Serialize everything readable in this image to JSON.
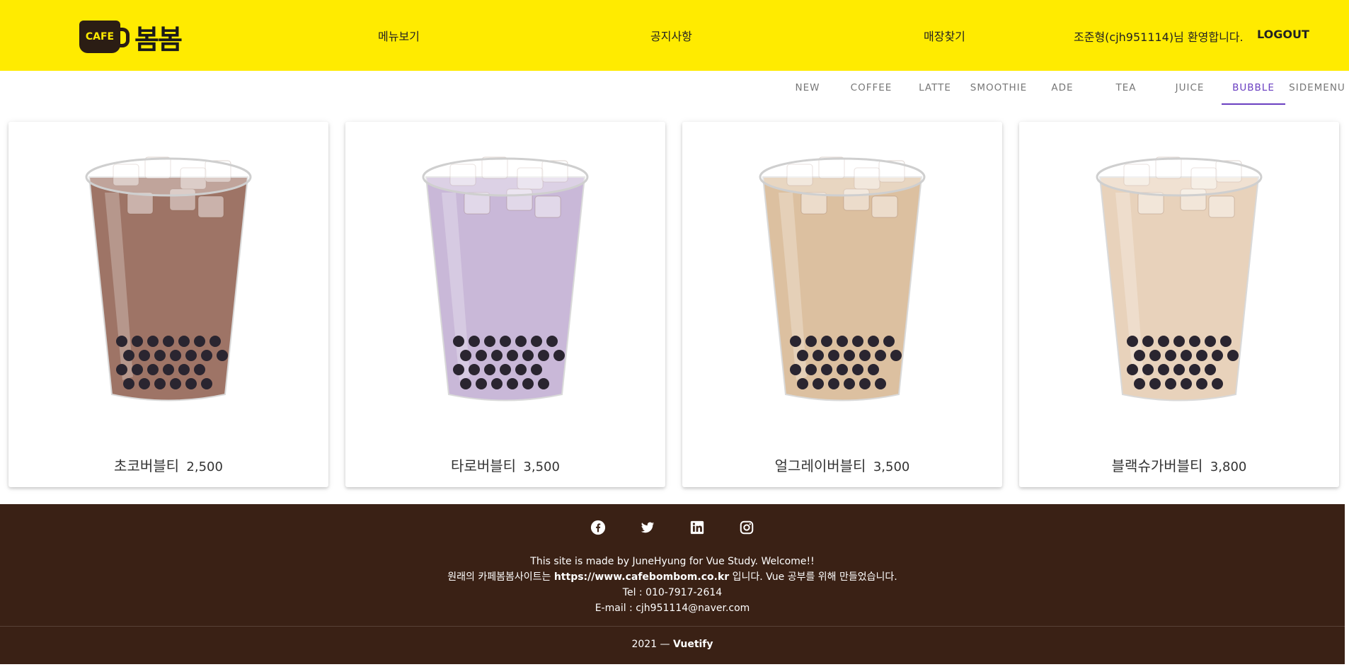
{
  "header": {
    "logo_badge": "CAFE",
    "logo_name": "봄봄",
    "nav": [
      "메뉴보기",
      "공지사항",
      "매장찾기"
    ],
    "welcome": "조준형(cjh951114)님 환영합니다.",
    "logout": "LOGOUT",
    "background_color": "#ffeb00"
  },
  "tabs": {
    "items": [
      "NEW",
      "COFFEE",
      "LATTE",
      "SMOOTHIE",
      "ADE",
      "TEA",
      "JUICE",
      "BUBBLE",
      "SIDEMENU"
    ],
    "active": "BUBBLE",
    "active_color": "#6a3fc1"
  },
  "products": [
    {
      "name": "초코버블티",
      "price": "2,500",
      "drink_color": "#9e7466"
    },
    {
      "name": "타로버블티",
      "price": "3,500",
      "drink_color": "#c9b8d8"
    },
    {
      "name": "얼그레이버블티",
      "price": "3,500",
      "drink_color": "#dcc0a0"
    },
    {
      "name": "블랙슈가버블티",
      "price": "3,800",
      "drink_color": "#e8d2bb"
    }
  ],
  "footer": {
    "social_icons": [
      "facebook-icon",
      "twitter-icon",
      "linkedin-icon",
      "instagram-icon"
    ],
    "line1": "This site is made by JuneHyung for Vue Study. Welcome!!",
    "line2_prefix": "원래의 카페봄봄사이트는",
    "line2_link": "https://www.cafebombom.co.kr",
    "line2_suffix": "입니다. Vue 공부를 위해 만들었습니다.",
    "tel": "Tel : 010-7917-2614",
    "email": "E-mail : cjh951114@naver.com",
    "copyright_year": "2021 —",
    "copyright_brand": "Vuetify",
    "background_color": "#3a2115"
  }
}
